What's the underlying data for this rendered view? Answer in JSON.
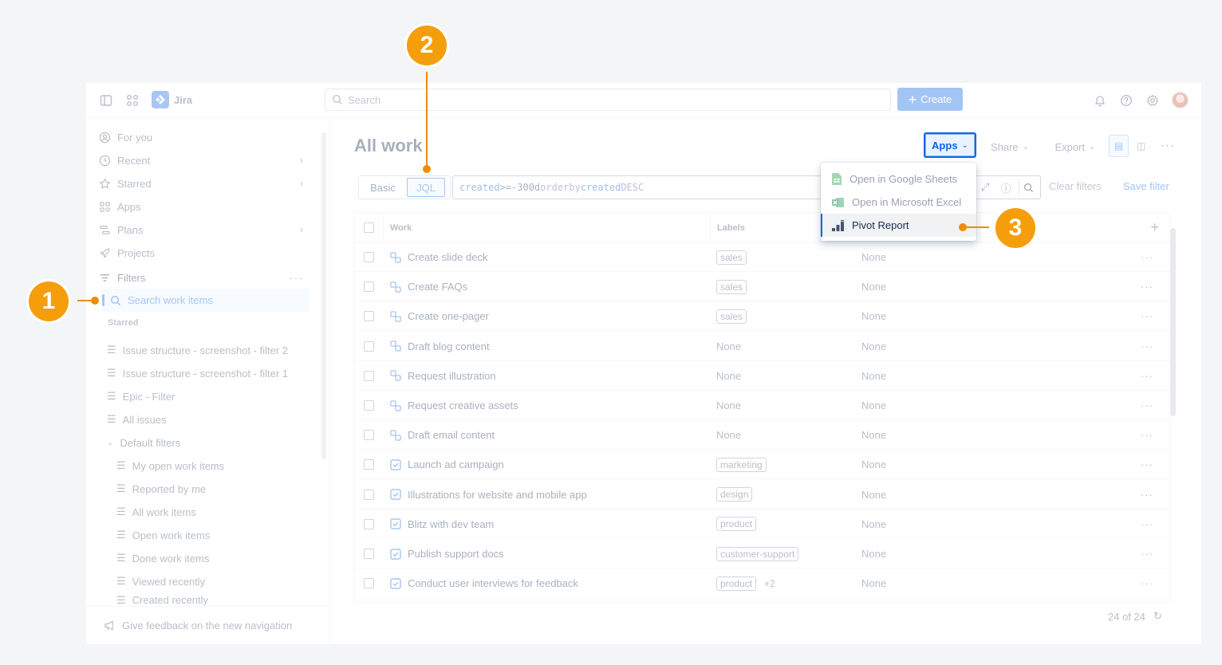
{
  "topbar": {
    "app_name": "Jira",
    "search_placeholder": "Search",
    "create_label": "Create"
  },
  "sidebar": {
    "nav": [
      {
        "label": "For you",
        "icon": "person-circle-icon"
      },
      {
        "label": "Recent",
        "icon": "clock-icon"
      },
      {
        "label": "Starred",
        "icon": "star-icon"
      },
      {
        "label": "Apps",
        "icon": "apps-grid-icon"
      },
      {
        "label": "Plans",
        "icon": "plans-icon"
      },
      {
        "label": "Projects",
        "icon": "rocket-icon"
      }
    ],
    "filters_label": "Filters",
    "active_item": "Search work items",
    "starred_heading": "Starred",
    "starred_filters": [
      "Issue structure - screenshot - filter 2",
      "Issue structure - screenshot - filter 1",
      "Epic - Filter",
      "All issues"
    ],
    "default_filters_label": "Default filters",
    "default_filters": [
      "My open work items",
      "Reported by me",
      "All work items",
      "Open work items",
      "Done work items",
      "Viewed recently",
      "Created recently"
    ],
    "feedback": "Give feedback on the new navigation"
  },
  "main": {
    "title": "All work",
    "apps_label": "Apps",
    "share_label": "Share",
    "export_label": "Export",
    "mode_basic": "Basic",
    "mode_jql": "JQL",
    "jql": {
      "field1": "created",
      "op": ">=",
      "value": "-300d",
      "kw1": "order",
      "kw2": "by",
      "field2": "created",
      "dir": "DESC"
    },
    "clear_filters": "Clear filters",
    "save_filter": "Save filter",
    "columns": {
      "work": "Work",
      "labels": "Labels"
    },
    "rows": [
      {
        "type": "subtask",
        "work": "Create slide deck",
        "label": "sales",
        "extra": "",
        "col3": "None"
      },
      {
        "type": "subtask",
        "work": "Create FAQs",
        "label": "sales",
        "extra": "",
        "col3": "None"
      },
      {
        "type": "subtask",
        "work": "Create one-pager",
        "label": "sales",
        "extra": "",
        "col3": "None"
      },
      {
        "type": "subtask",
        "work": "Draft blog content",
        "label": "",
        "none_label": "None",
        "extra": "",
        "col3": "None"
      },
      {
        "type": "subtask",
        "work": "Request illustration",
        "label": "",
        "none_label": "None",
        "extra": "",
        "col3": "None"
      },
      {
        "type": "subtask",
        "work": "Request creative assets",
        "label": "",
        "none_label": "None",
        "extra": "",
        "col3": "None"
      },
      {
        "type": "subtask",
        "work": "Draft email content",
        "label": "",
        "none_label": "None",
        "extra": "",
        "col3": "None"
      },
      {
        "type": "task",
        "work": "Launch ad campaign",
        "label": "marketing",
        "extra": "",
        "col3": "None"
      },
      {
        "type": "task",
        "work": "Illustrations for website and mobile app",
        "label": "design",
        "extra": "",
        "col3": "None"
      },
      {
        "type": "task",
        "work": "Blitz with dev team",
        "label": "product",
        "extra": "",
        "col3": "None"
      },
      {
        "type": "task",
        "work": "Publish support docs",
        "label": "customer-support",
        "extra": "",
        "col3": "None"
      },
      {
        "type": "task",
        "work": "Conduct user interviews for feedback",
        "label": "product",
        "extra": "+2",
        "col3": "None"
      }
    ],
    "count": "24 of 24"
  },
  "apps_menu": [
    {
      "label": "Open in Google Sheets",
      "icon": "google-sheets-icon"
    },
    {
      "label": "Open in Microsoft Excel",
      "icon": "excel-icon"
    },
    {
      "label": "Pivot Report",
      "icon": "pivot-chart-icon"
    }
  ],
  "callouts": [
    "1",
    "2",
    "3"
  ],
  "colors": {
    "accent": "#0c66e4",
    "callout": "#f59e0b"
  }
}
